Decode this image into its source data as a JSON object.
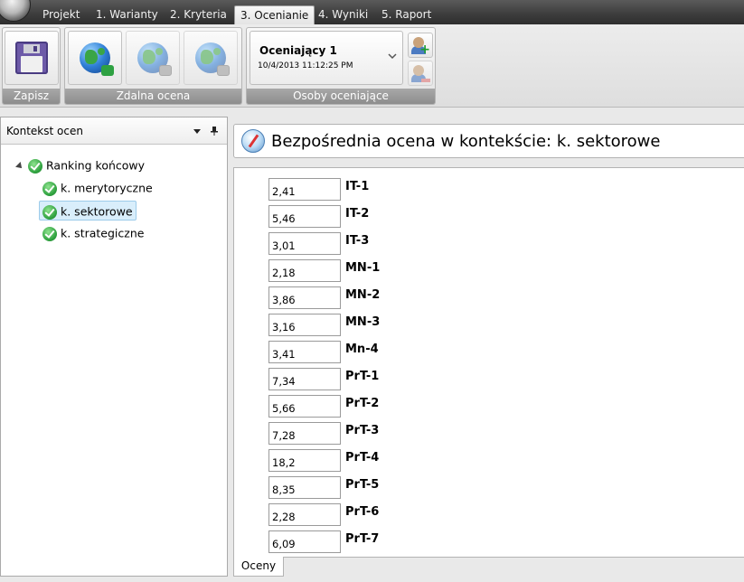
{
  "ribbon_tabs": [
    {
      "label": "Projekt"
    },
    {
      "label": "1. Warianty"
    },
    {
      "label": "2. Kryteria"
    },
    {
      "label": "3. Ocenianie"
    },
    {
      "label": "4. Wyniki"
    },
    {
      "label": "5. Raport"
    }
  ],
  "ribbon": {
    "save_group_label": "Zapisz",
    "remote_group_label": "Zdalna ocena",
    "assessors_group_label": "Osoby oceniające",
    "assessor": {
      "name": "Oceniający 1",
      "date": "10/4/2013 11:12:25 PM"
    }
  },
  "left_panel": {
    "title": "Kontekst ocen",
    "tree": {
      "root": "Ranking końcowy",
      "children": [
        "k. merytoryczne",
        "k. sektorowe",
        "k. strategiczne"
      ],
      "selected": "k. sektorowe"
    }
  },
  "main": {
    "title": "Bezpośrednia ocena w kontekście: k. sektorowe",
    "ratings": [
      {
        "value": "2,41",
        "label": "IT-1"
      },
      {
        "value": "5,46",
        "label": "IT-2"
      },
      {
        "value": "3,01",
        "label": "IT-3"
      },
      {
        "value": "2,18",
        "label": "MN-1"
      },
      {
        "value": "3,86",
        "label": "MN-2"
      },
      {
        "value": "3,16",
        "label": "MN-3"
      },
      {
        "value": "3,41",
        "label": "Mn-4"
      },
      {
        "value": "7,34",
        "label": "PrT-1"
      },
      {
        "value": "5,66",
        "label": "PrT-2"
      },
      {
        "value": "7,28",
        "label": "PrT-3"
      },
      {
        "value": "18,2",
        "label": "PrT-4"
      },
      {
        "value": "8,35",
        "label": "PrT-5"
      },
      {
        "value": "2,28",
        "label": "PrT-6"
      },
      {
        "value": "6,09",
        "label": "PrT-7"
      }
    ],
    "bottom_tab": "Oceny"
  },
  "icons": {
    "app_orb": "app-menu-orb-icon",
    "save": "floppy-disk-icon",
    "remote": [
      "globe-download-icon",
      "globe-refresh-icon",
      "globe-link-icon"
    ],
    "add_person": "add-person-icon",
    "remove_person": "remove-person-icon",
    "check": "green-check-icon",
    "compass": "compass-icon"
  }
}
